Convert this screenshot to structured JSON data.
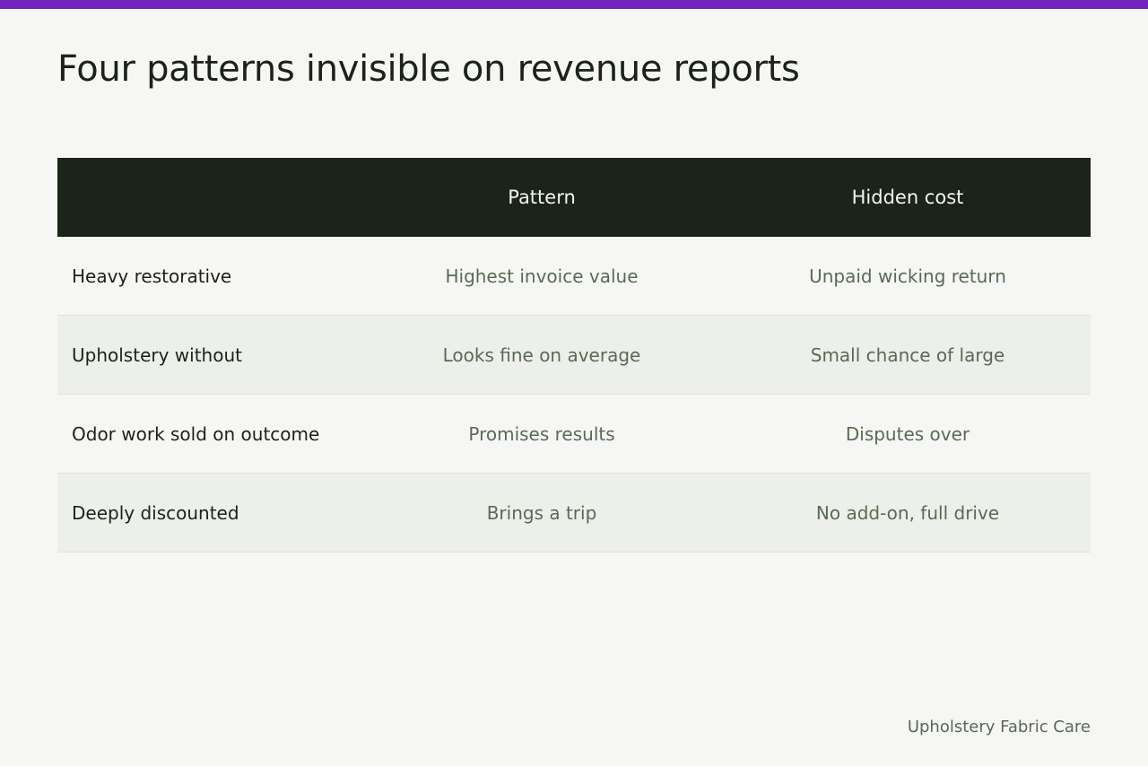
{
  "page": {
    "title": "Four patterns invisible on revenue reports",
    "footer": "Upholstery Fabric Care",
    "accent_color": "#7323bf"
  },
  "table": {
    "headers": [
      "",
      "Pattern",
      "Hidden cost"
    ],
    "rows": [
      {
        "label": "Heavy restorative",
        "pattern": "Highest invoice value",
        "cost": "Unpaid wicking return"
      },
      {
        "label": "Upholstery without",
        "pattern": "Looks fine on average",
        "cost": "Small chance of large"
      },
      {
        "label": "Odor work sold on outcome",
        "pattern": "Promises results",
        "cost": "Disputes over"
      },
      {
        "label": "Deeply discounted",
        "pattern": "Brings a trip",
        "cost": "No add-on, full drive"
      }
    ]
  }
}
